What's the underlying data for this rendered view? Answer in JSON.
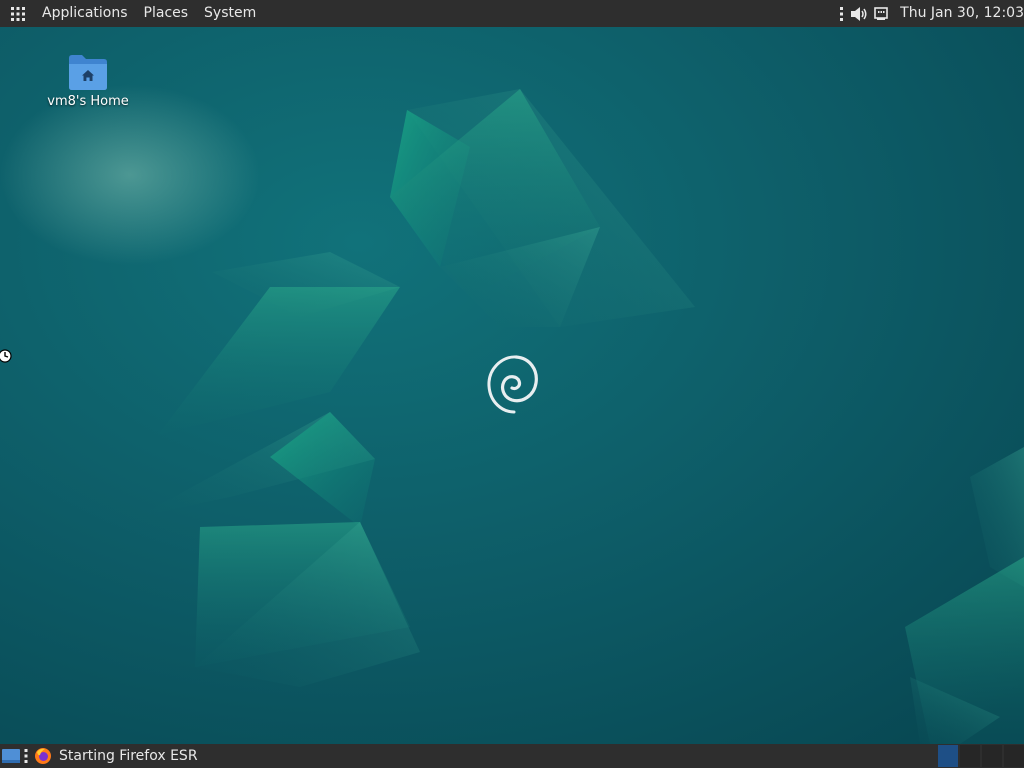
{
  "top_panel": {
    "menus": [
      {
        "label": "Applications"
      },
      {
        "label": "Places"
      },
      {
        "label": "System"
      }
    ],
    "tray_icons": [
      "more-icon",
      "volume-icon",
      "network-icon"
    ],
    "clock": "Thu Jan 30, 12:03"
  },
  "desktop": {
    "icons": [
      {
        "label": "vm8's Home",
        "icon": "home-folder-icon"
      }
    ],
    "wallpaper_logo": "debian-swirl-icon"
  },
  "bottom_panel": {
    "tasks": [
      {
        "label": "Starting Firefox ESR",
        "icon": "firefox-icon"
      }
    ],
    "workspaces": {
      "count": 4,
      "active_index": 0
    }
  },
  "colors": {
    "panel": "#2e2e2e",
    "panel_text": "#e8e8e8",
    "wallpaper_base": "#0d5560",
    "folder": "#4a90d9"
  }
}
